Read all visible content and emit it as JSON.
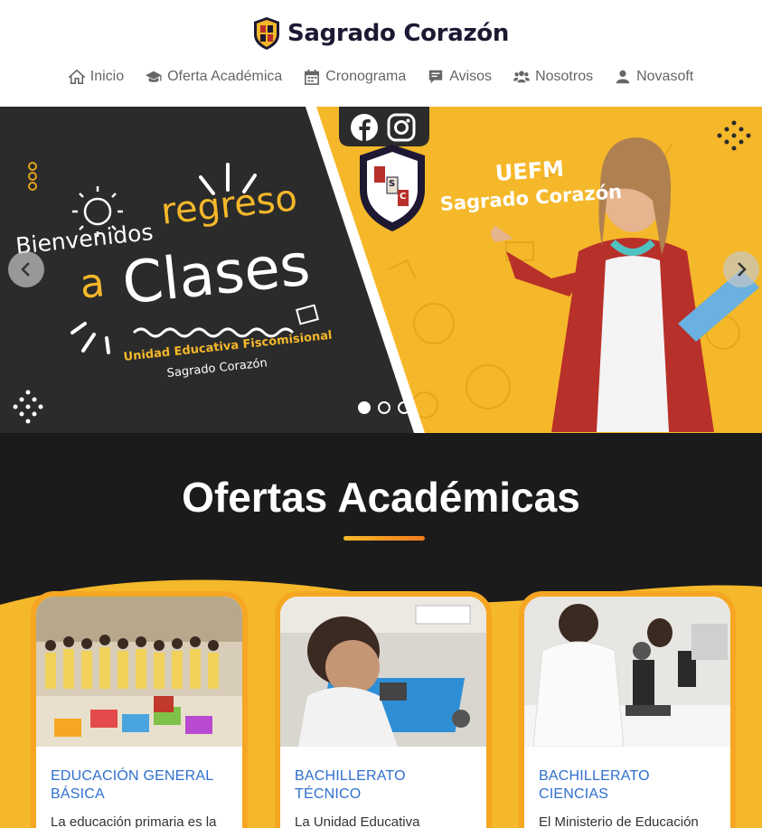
{
  "header": {
    "brand": "Sagrado Corazón",
    "nav": [
      {
        "label": "Inicio",
        "icon": "home-icon"
      },
      {
        "label": "Oferta Académica",
        "icon": "graduation-cap-icon"
      },
      {
        "label": "Cronograma",
        "icon": "calendar-icon"
      },
      {
        "label": "Avisos",
        "icon": "message-icon"
      },
      {
        "label": "Nosotros",
        "icon": "users-icon"
      },
      {
        "label": "Novasoft",
        "icon": "user-icon"
      }
    ]
  },
  "banner": {
    "bienvenidos": "Bienvenidos",
    "regreso": "regreso",
    "a": "a",
    "clases": "Clases",
    "unidad": "Unidad Educativa Fiscomisional",
    "sagrado": "Sagrado Corazón",
    "uefm": "UEFM",
    "uefm_sub": "Sagrado Corazón",
    "shield_letters": [
      "S",
      "C"
    ],
    "slides_total": 3,
    "active_slide": 1
  },
  "ofertas": {
    "title": "Ofertas Académicas",
    "cards": [
      {
        "title": "EDUCACIÓN GENERAL BÁSICA",
        "text": "La educación primaria es la"
      },
      {
        "title": "BACHILLERATO TÉCNICO",
        "text": "La Unidad Educativa"
      },
      {
        "title": "BACHILLERATO CIENCIAS",
        "text": "El Ministerio de Educación"
      }
    ]
  },
  "colors": {
    "accent": "#f5b82a",
    "dark": "#1b1b1b",
    "link": "#2f6fcf",
    "brand": "#1e1833"
  }
}
